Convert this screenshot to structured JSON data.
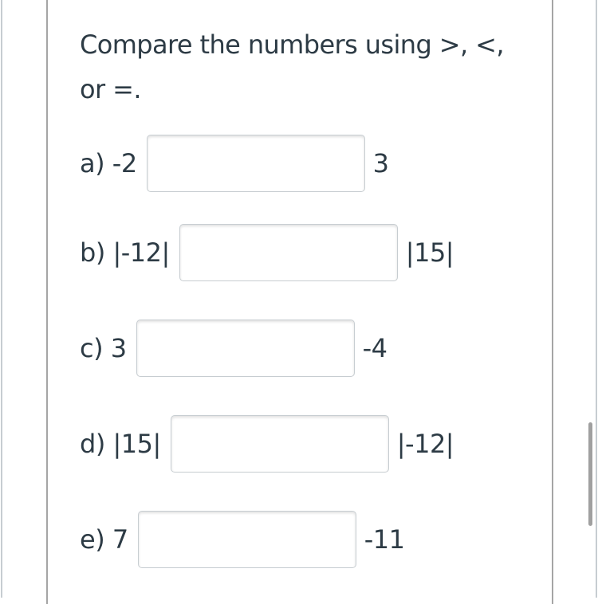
{
  "question": {
    "text": "Compare the numbers using >, <, or =."
  },
  "items": [
    {
      "label": "a) -2",
      "answer": "",
      "rhs": "3"
    },
    {
      "label": "b) |-12|",
      "answer": "",
      "rhs": "|15|"
    },
    {
      "label": "c) 3",
      "answer": "",
      "rhs": "-4"
    },
    {
      "label": "d) |15|",
      "answer": "",
      "rhs": "|-12|"
    },
    {
      "label": "e) 7",
      "answer": "",
      "rhs": "-11"
    }
  ]
}
